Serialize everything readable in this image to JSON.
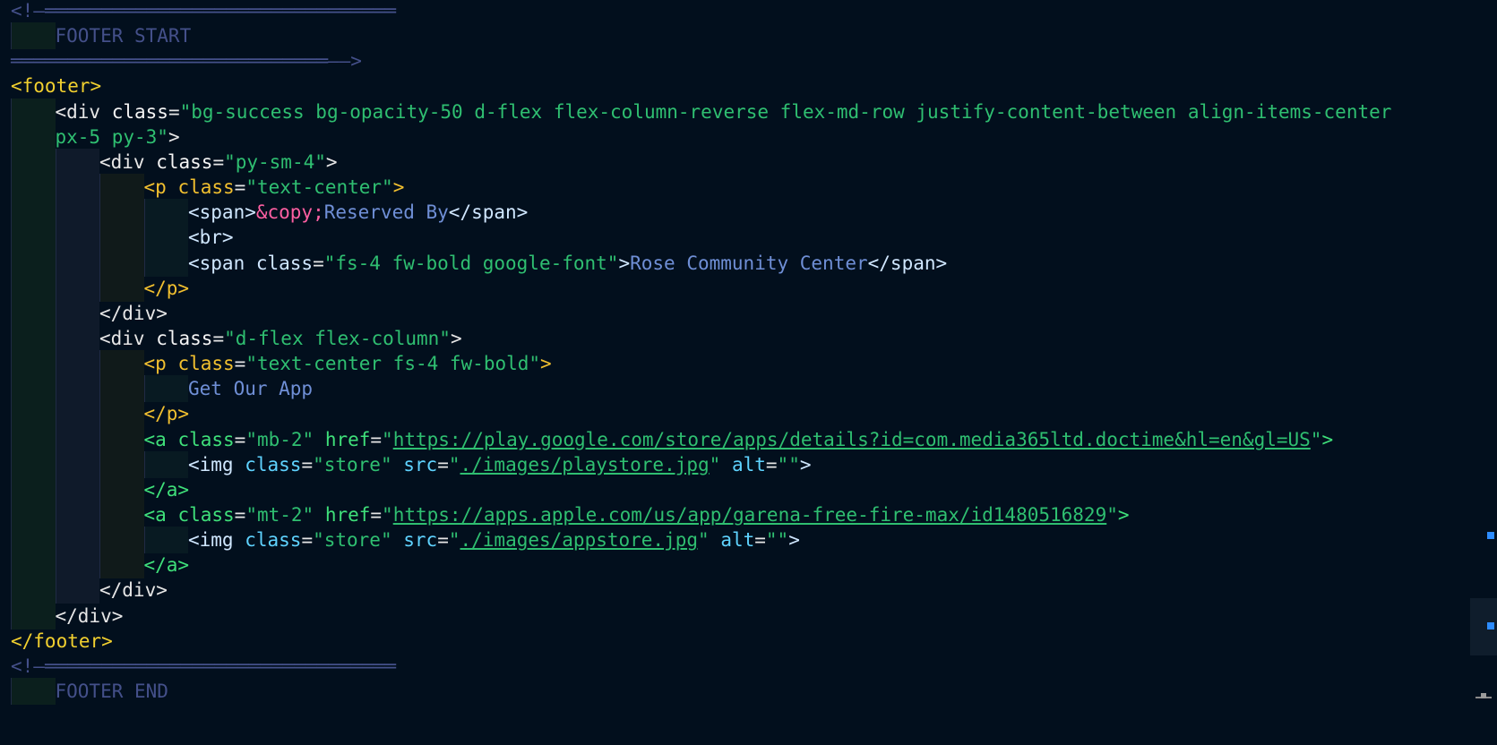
{
  "editor": {
    "lines": [
      {
        "tokens": [
          {
            "t": "<!—",
            "c": "t-comment"
          },
          {
            "t": "═══════════════════════════════",
            "c": "t-comment"
          }
        ]
      },
      {
        "tokens": [
          {
            "t": "FOOTER START",
            "c": "t-comment"
          }
        ]
      },
      {
        "tokens": [
          {
            "t": "════════════════════════════",
            "c": "t-comment"
          },
          {
            "t": "——>",
            "c": "t-comment"
          }
        ]
      },
      {
        "tokens": [
          {
            "t": "<footer>",
            "c": "t-footer"
          }
        ]
      },
      {
        "tokens": [
          {
            "t": "<div ",
            "c": "t-white"
          },
          {
            "t": "class",
            "c": "t-attr"
          },
          {
            "t": "=",
            "c": "t-white"
          },
          {
            "t": "\"bg-success bg-opacity-50 d-flex flex-column-reverse flex-md-row justify-content-between align-items-center",
            "c": "t-str"
          }
        ]
      },
      {
        "tokens": [
          {
            "t": "px-5 py-3\"",
            "c": "t-str"
          },
          {
            "t": ">",
            "c": "t-white"
          }
        ]
      },
      {
        "tokens": [
          {
            "t": "<div ",
            "c": "t-white"
          },
          {
            "t": "class",
            "c": "t-attr"
          },
          {
            "t": "=",
            "c": "t-white"
          },
          {
            "t": "\"py-sm-4\"",
            "c": "t-str"
          },
          {
            "t": ">",
            "c": "t-white"
          }
        ]
      },
      {
        "tokens": [
          {
            "t": "<p ",
            "c": "t-p"
          },
          {
            "t": "class",
            "c": "t-p"
          },
          {
            "t": "=",
            "c": "t-white"
          },
          {
            "t": "\"text-center\"",
            "c": "t-str"
          },
          {
            "t": ">",
            "c": "t-p"
          }
        ]
      },
      {
        "tokens": [
          {
            "t": "<span>",
            "c": "t-span"
          },
          {
            "t": "&copy;",
            "c": "t-entity"
          },
          {
            "t": "Reserved By",
            "c": "t-text"
          },
          {
            "t": "</span>",
            "c": "t-span"
          }
        ]
      },
      {
        "tokens": [
          {
            "t": "<br>",
            "c": "t-span"
          }
        ]
      },
      {
        "tokens": [
          {
            "t": "<span ",
            "c": "t-span"
          },
          {
            "t": "class",
            "c": "t-span"
          },
          {
            "t": "=",
            "c": "t-white"
          },
          {
            "t": "\"fs-4 fw-bold google-font\"",
            "c": "t-str"
          },
          {
            "t": ">",
            "c": "t-span"
          },
          {
            "t": "Rose Community Center",
            "c": "t-text"
          },
          {
            "t": "</span>",
            "c": "t-span"
          }
        ]
      },
      {
        "tokens": [
          {
            "t": "</p>",
            "c": "t-p"
          }
        ]
      },
      {
        "tokens": [
          {
            "t": "</div>",
            "c": "t-white"
          }
        ]
      },
      {
        "tokens": [
          {
            "t": "<div ",
            "c": "t-white"
          },
          {
            "t": "class",
            "c": "t-attr"
          },
          {
            "t": "=",
            "c": "t-white"
          },
          {
            "t": "\"d-flex flex-column\"",
            "c": "t-str"
          },
          {
            "t": ">",
            "c": "t-white"
          }
        ]
      },
      {
        "tokens": [
          {
            "t": "<p ",
            "c": "t-p"
          },
          {
            "t": "class",
            "c": "t-p"
          },
          {
            "t": "=",
            "c": "t-white"
          },
          {
            "t": "\"text-center fs-4 fw-bold\"",
            "c": "t-str"
          },
          {
            "t": ">",
            "c": "t-p"
          }
        ]
      },
      {
        "tokens": [
          {
            "t": "Get Our App",
            "c": "t-text"
          }
        ]
      },
      {
        "tokens": [
          {
            "t": "</p>",
            "c": "t-p"
          }
        ]
      },
      {
        "tokens": [
          {
            "t": "<a ",
            "c": "t-a"
          },
          {
            "t": "class",
            "c": "t-a"
          },
          {
            "t": "=",
            "c": "t-white"
          },
          {
            "t": "\"mb-2\"",
            "c": "t-str"
          },
          {
            "t": " href",
            "c": "t-a"
          },
          {
            "t": "=",
            "c": "t-white"
          },
          {
            "t": "\"",
            "c": "t-str"
          },
          {
            "t": "https://play.google.com/store/apps/details?id=com.media365ltd.doctime&hl=en&gl=US",
            "c": "t-link"
          },
          {
            "t": "\"",
            "c": "t-str"
          },
          {
            "t": ">",
            "c": "t-a"
          }
        ]
      },
      {
        "tokens": [
          {
            "t": "<img ",
            "c": "t-span"
          },
          {
            "t": "class",
            "c": "t-img-attr"
          },
          {
            "t": "=",
            "c": "t-white"
          },
          {
            "t": "\"store\"",
            "c": "t-str"
          },
          {
            "t": " src",
            "c": "t-img-attr"
          },
          {
            "t": "=",
            "c": "t-white"
          },
          {
            "t": "\"",
            "c": "t-str"
          },
          {
            "t": "./images/playstore.jpg",
            "c": "t-link"
          },
          {
            "t": "\"",
            "c": "t-str"
          },
          {
            "t": " alt",
            "c": "t-img-attr"
          },
          {
            "t": "=",
            "c": "t-white"
          },
          {
            "t": "\"\"",
            "c": "t-str"
          },
          {
            "t": ">",
            "c": "t-span"
          }
        ]
      },
      {
        "tokens": [
          {
            "t": "</a>",
            "c": "t-a"
          }
        ]
      },
      {
        "tokens": [
          {
            "t": "<a ",
            "c": "t-a"
          },
          {
            "t": "class",
            "c": "t-a"
          },
          {
            "t": "=",
            "c": "t-white"
          },
          {
            "t": "\"mt-2\"",
            "c": "t-str"
          },
          {
            "t": " href",
            "c": "t-a"
          },
          {
            "t": "=",
            "c": "t-white"
          },
          {
            "t": "\"",
            "c": "t-str"
          },
          {
            "t": "https://apps.apple.com/us/app/garena-free-fire-max/id1480516829",
            "c": "t-link"
          },
          {
            "t": "\"",
            "c": "t-str"
          },
          {
            "t": ">",
            "c": "t-a"
          }
        ]
      },
      {
        "tokens": [
          {
            "t": "<img ",
            "c": "t-span"
          },
          {
            "t": "class",
            "c": "t-img-attr"
          },
          {
            "t": "=",
            "c": "t-white"
          },
          {
            "t": "\"store\"",
            "c": "t-str"
          },
          {
            "t": " src",
            "c": "t-img-attr"
          },
          {
            "t": "=",
            "c": "t-white"
          },
          {
            "t": "\"",
            "c": "t-str"
          },
          {
            "t": "./images/appstore.jpg",
            "c": "t-link"
          },
          {
            "t": "\"",
            "c": "t-str"
          },
          {
            "t": " alt",
            "c": "t-img-attr"
          },
          {
            "t": "=",
            "c": "t-white"
          },
          {
            "t": "\"\"",
            "c": "t-str"
          },
          {
            "t": ">",
            "c": "t-span"
          }
        ]
      },
      {
        "tokens": [
          {
            "t": "</a>",
            "c": "t-a"
          }
        ]
      },
      {
        "tokens": [
          {
            "t": "</div>",
            "c": "t-white"
          }
        ]
      },
      {
        "tokens": [
          {
            "t": "</div>",
            "c": "t-white"
          }
        ]
      },
      {
        "tokens": [
          {
            "t": "</footer>",
            "c": "t-footer"
          }
        ]
      },
      {
        "tokens": [
          {
            "t": "<!—",
            "c": "t-comment"
          },
          {
            "t": "═══════════════════════════════",
            "c": "t-comment"
          }
        ]
      },
      {
        "tokens": [
          {
            "t": "FOOTER END",
            "c": "t-comment"
          }
        ]
      }
    ]
  },
  "colors": {
    "background": "#020f1d",
    "string": "#2fbf71",
    "text": "#6f8fd6",
    "p_tag": "#f2c02f",
    "entity": "#ff5fa2",
    "comment": "#44508a",
    "minimap_marker": "#2d8cff"
  }
}
